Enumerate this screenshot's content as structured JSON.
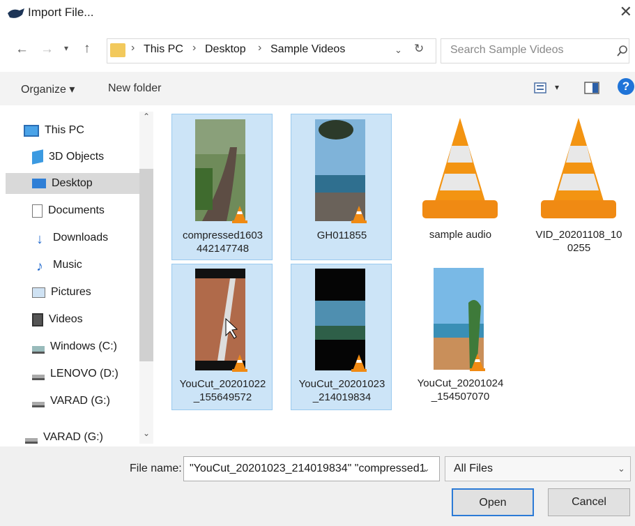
{
  "window": {
    "title": "Import File..."
  },
  "nav": {
    "breadcrumbs": [
      "This PC",
      "Desktop",
      "Sample Videos"
    ],
    "search_placeholder": "Search Sample Videos"
  },
  "toolbar": {
    "organize": "Organize ▾",
    "new_folder": "New folder"
  },
  "sidebar": {
    "items": [
      {
        "label": "This PC",
        "icon": "monitor-icon"
      },
      {
        "label": "3D Objects",
        "icon": "cube-icon"
      },
      {
        "label": "Desktop",
        "icon": "desktop-icon",
        "selected": true
      },
      {
        "label": "Documents",
        "icon": "document-icon"
      },
      {
        "label": "Downloads",
        "icon": "download-arrow-icon"
      },
      {
        "label": "Music",
        "icon": "music-note-icon"
      },
      {
        "label": "Pictures",
        "icon": "picture-icon"
      },
      {
        "label": "Videos",
        "icon": "film-icon"
      },
      {
        "label": "Windows (C:)",
        "icon": "drive-icon"
      },
      {
        "label": "LENOVO (D:)",
        "icon": "drive-icon"
      },
      {
        "label": "VARAD (G:)",
        "icon": "drive-icon"
      },
      {
        "label": "VARAD (G:)",
        "icon": "drive-icon"
      }
    ]
  },
  "files": [
    {
      "name_line1": "compressed1603",
      "name_line2": "442147748",
      "selected": true
    },
    {
      "name_line1": "GH011855",
      "name_line2": "",
      "selected": true
    },
    {
      "name_line1": "sample audio",
      "name_line2": "",
      "selected": false
    },
    {
      "name_line1": "VID_20201108_10",
      "name_line2": "0255",
      "selected": false
    },
    {
      "name_line1": "YouCut_20201022",
      "name_line2": "_155649572",
      "selected": true
    },
    {
      "name_line1": "YouCut_20201023",
      "name_line2": "_214019834",
      "selected": true
    },
    {
      "name_line1": "YouCut_20201024",
      "name_line2": "_154507070",
      "selected": false
    }
  ],
  "bottom": {
    "file_name_label": "File name:",
    "file_name_value": "\"YouCut_20201023_214019834\" \"compressed1",
    "filter": "All Files",
    "open": "Open",
    "cancel": "Cancel"
  },
  "colors": {
    "selection": "#cce4f7",
    "accent": "#1f74d8",
    "vlc_orange": "#f08a13"
  }
}
